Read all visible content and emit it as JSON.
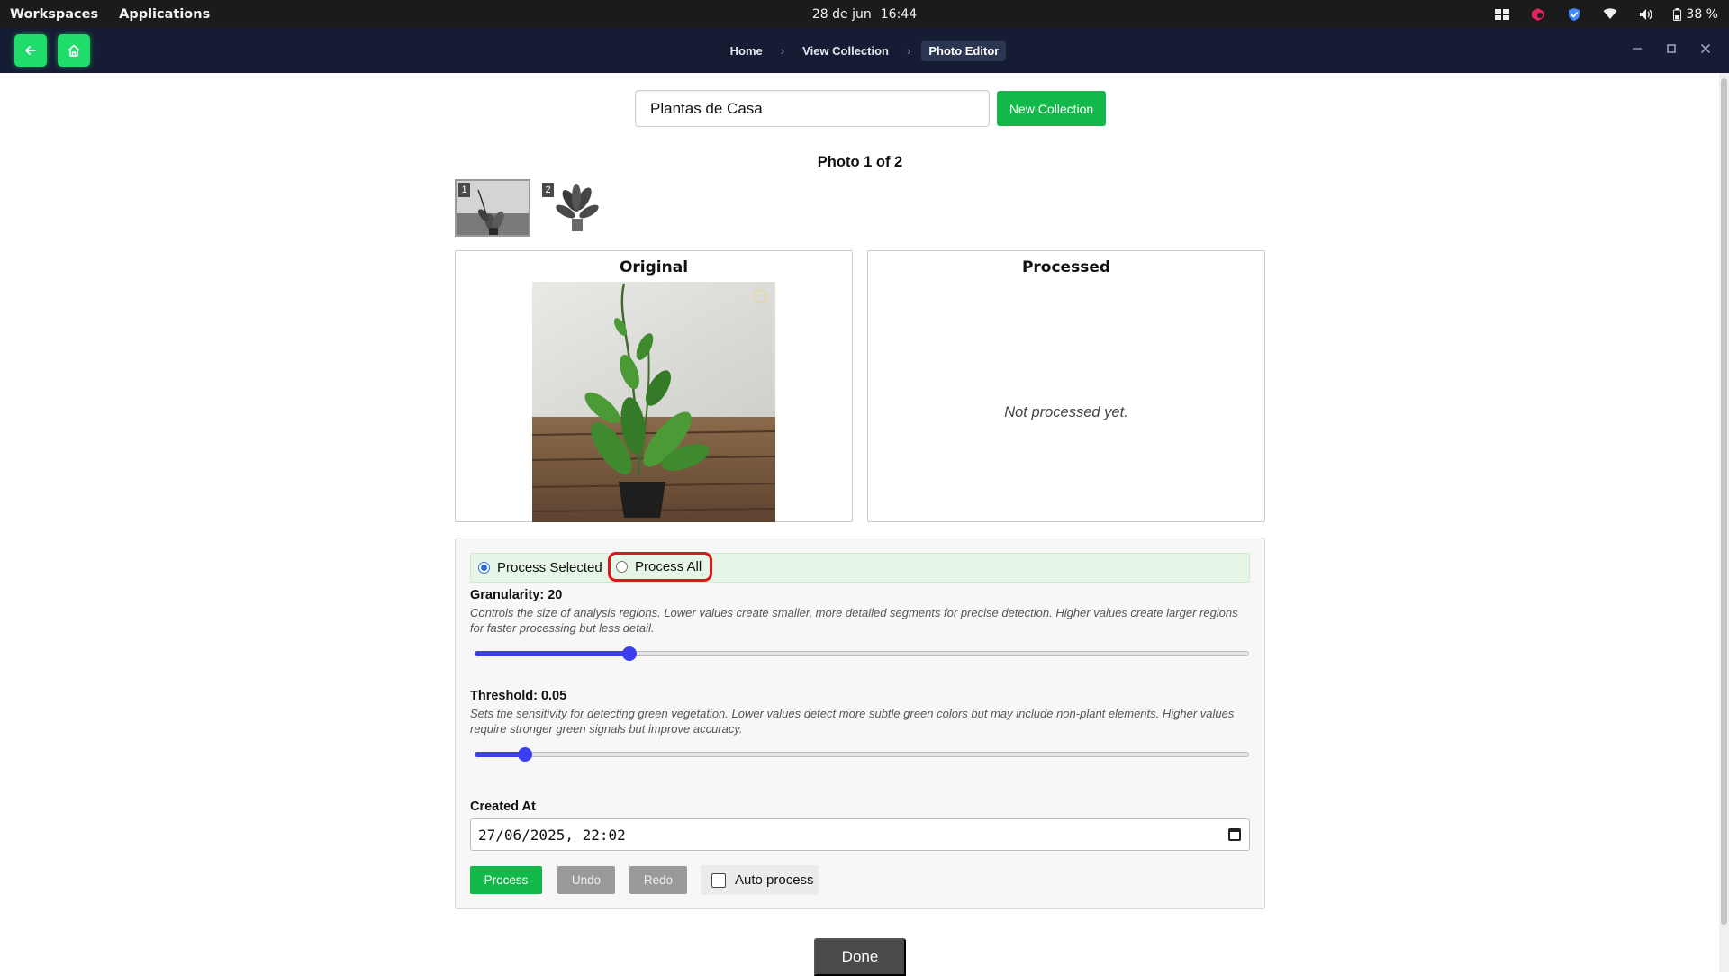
{
  "system_bar": {
    "workspaces": "Workspaces",
    "applications": "Applications",
    "date": "28 de jun",
    "time": "16:44",
    "battery": "38 %",
    "icons": [
      "layout-icon",
      "app-icon",
      "shield-icon",
      "wifi-icon",
      "volume-icon",
      "battery-icon"
    ]
  },
  "app_bar": {
    "breadcrumbs": [
      "Home",
      "View Collection",
      "Photo Editor"
    ],
    "active_crumb": "Photo Editor",
    "back_icon": "arrow-left-icon",
    "home_icon": "home-icon",
    "accent_color": "#1fdc6b",
    "background_color": "#151c33"
  },
  "collection": {
    "name_value": "Plantas de Casa",
    "new_button": "New Collection"
  },
  "photos": {
    "counter": "Photo 1 of 2",
    "thumbnails": [
      {
        "number": "1",
        "selected": true
      },
      {
        "number": "2",
        "selected": false
      }
    ]
  },
  "panels": {
    "original_title": "Original",
    "processed_title": "Processed",
    "processed_empty": "Not processed yet."
  },
  "controls": {
    "mode_selected": "Process Selected",
    "mode_all": "Process All",
    "current_mode": "Process Selected",
    "granularity": {
      "label": "Granularity: 20",
      "description": "Controls the size of analysis regions. Lower values create smaller, more detailed segments for precise detection. Higher values create larger regions for faster processing but less detail.",
      "fraction": 0.2
    },
    "threshold": {
      "label": "Threshold: 0.05",
      "description": "Sets the sensitivity for detecting green vegetation. Lower values detect more subtle green colors but may include non-plant elements. Higher values require stronger green signals but improve accuracy.",
      "fraction": 0.065
    },
    "created_at_label": "Created At",
    "created_at_value": "27/06/2025, 22:02",
    "process_button": "Process",
    "undo_button": "Undo",
    "redo_button": "Redo",
    "auto_process_label": "Auto process",
    "auto_process_checked": false
  },
  "done_button": "Done",
  "colors": {
    "primary_green": "#12b84a",
    "slider_blue": "#3b3ff0",
    "highlight_red": "#e2141c"
  }
}
